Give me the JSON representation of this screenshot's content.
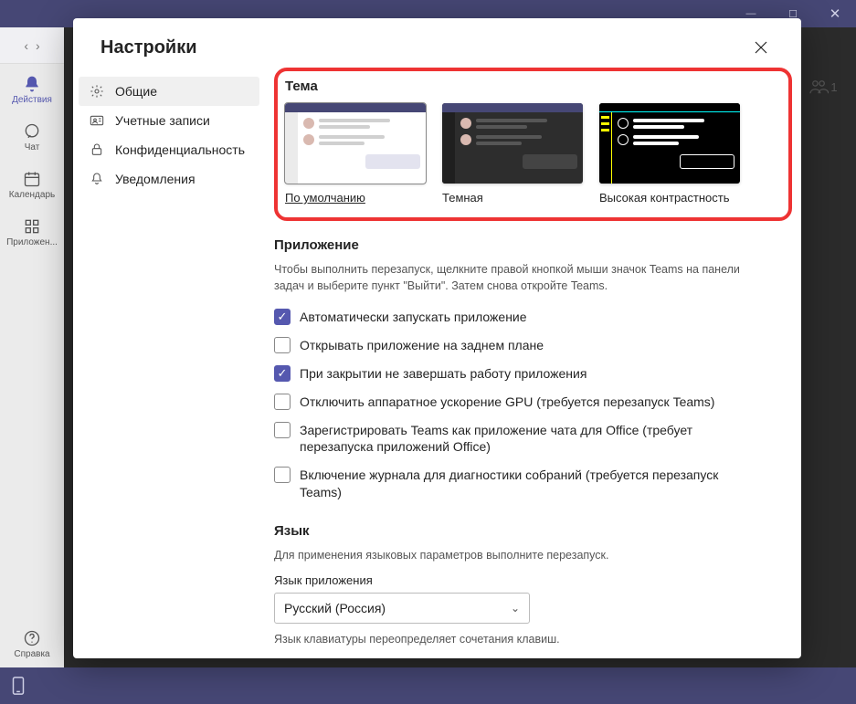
{
  "titlebar": {
    "buttons": [
      "—",
      "☐",
      "✕"
    ]
  },
  "leftRail": {
    "items": [
      {
        "label": "Действия",
        "icon": "bell"
      },
      {
        "label": "Чат",
        "icon": "chat"
      },
      {
        "label": "Календарь",
        "icon": "calendar"
      },
      {
        "label": "Приложен...",
        "icon": "apps"
      }
    ],
    "help": "Справка"
  },
  "rightBadge": "1",
  "modal": {
    "title": "Настройки",
    "sideNav": [
      {
        "label": "Общие",
        "icon": "gear",
        "active": true
      },
      {
        "label": "Учетные записи",
        "icon": "id-card"
      },
      {
        "label": "Конфиденциальность",
        "icon": "lock"
      },
      {
        "label": "Уведомления",
        "icon": "bell-outline"
      }
    ],
    "theme": {
      "heading": "Тема",
      "options": [
        {
          "label": "По умолчанию",
          "kind": "default",
          "selected": true
        },
        {
          "label": "Темная",
          "kind": "dark"
        },
        {
          "label": "Высокая контрастность",
          "kind": "hc"
        }
      ]
    },
    "appSection": {
      "heading": "Приложение",
      "hint": "Чтобы выполнить перезапуск, щелкните правой кнопкой мыши значок Teams на панели задач и выберите пункт \"Выйти\". Затем снова откройте Teams.",
      "options": [
        {
          "label": "Автоматически запускать приложение",
          "checked": true
        },
        {
          "label": "Открывать приложение на заднем плане",
          "checked": false
        },
        {
          "label": "При закрытии не завершать работу приложения",
          "checked": true
        },
        {
          "label": "Отключить аппаратное ускорение GPU (требуется перезапуск Teams)",
          "checked": false
        },
        {
          "label": "Зарегистрировать Teams как приложение чата для Office (требует перезапуска приложений Office)",
          "checked": false
        },
        {
          "label": "Включение журнала для диагностики собраний (требуется перезапуск Teams)",
          "checked": false
        }
      ]
    },
    "langSection": {
      "heading": "Язык",
      "hint": "Для применения языковых параметров выполните перезапуск.",
      "appLangLabel": "Язык приложения",
      "appLangValue": "Русский (Россия)",
      "kbLangHint": "Язык клавиатуры переопределяет сочетания клавиш."
    }
  }
}
